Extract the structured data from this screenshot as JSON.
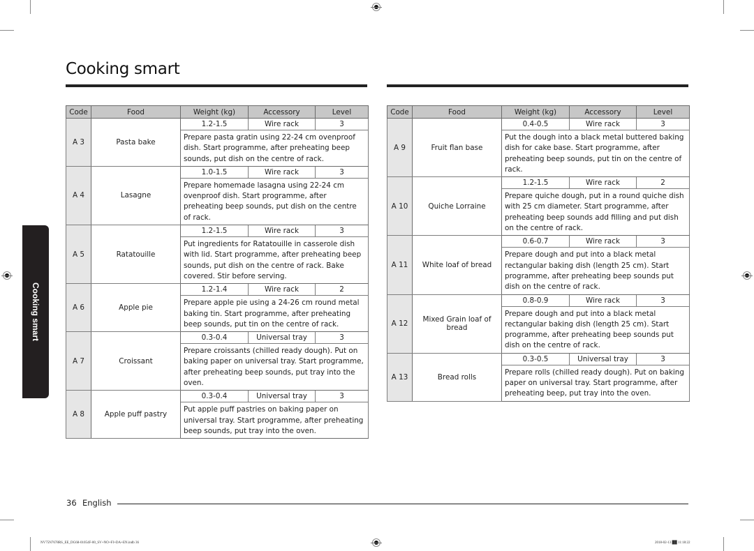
{
  "page": {
    "title": "Cooking smart",
    "side_tab": "Cooking smart",
    "page_number": "36",
    "language": "English"
  },
  "table_headers": {
    "code": "Code",
    "food": "Food",
    "weight": "Weight (kg)",
    "accessory": "Accessory",
    "level": "Level"
  },
  "left_table": [
    {
      "code": "A 3",
      "food": "Pasta bake",
      "weight": "1.2-1.5",
      "accessory": "Wire rack",
      "level": "3",
      "instructions": "Prepare pasta gratin using 22-24 cm ovenproof dish. Start programme, after preheating beep sounds, put dish on the centre of rack."
    },
    {
      "code": "A 4",
      "food": "Lasagne",
      "weight": "1.0-1.5",
      "accessory": "Wire rack",
      "level": "3",
      "instructions": "Prepare homemade lasagna using 22-24 cm ovenproof dish. Start programme, after preheating beep sounds, put dish on the centre of rack."
    },
    {
      "code": "A 5",
      "food": "Ratatouille",
      "weight": "1.2-1.5",
      "accessory": "Wire rack",
      "level": "3",
      "instructions": "Put ingredients for Ratatouille in casserole dish with lid. Start programme, after preheating beep sounds, put dish on the centre of rack. Bake covered. Stir before serving."
    },
    {
      "code": "A 6",
      "food": "Apple pie",
      "weight": "1.2-1.4",
      "accessory": "Wire rack",
      "level": "2",
      "instructions": "Prepare apple pie using a 24-26 cm round metal baking tin. Start programme, after preheating beep sounds, put tin on the centre of rack."
    },
    {
      "code": "A 7",
      "food": "Croissant",
      "weight": "0.3-0.4",
      "accessory": "Universal tray",
      "level": "3",
      "instructions": "Prepare croissants (chilled ready dough). Put on baking paper on universal tray. Start programme, after preheating beep sounds, put tray into the oven."
    },
    {
      "code": "A 8",
      "food": "Apple puff pastry",
      "weight": "0.3-0.4",
      "accessory": "Universal tray",
      "level": "3",
      "instructions": "Put apple puff pastries on baking paper on universal tray. Start programme, after preheating beep sounds, put tray into the oven."
    }
  ],
  "right_table": [
    {
      "code": "A 9",
      "food": "Fruit flan base",
      "weight": "0.4-0.5",
      "accessory": "Wire rack",
      "level": "3",
      "instructions": "Put the dough into a black metal buttered baking dish for cake base. Start programme, after preheating beep sounds, put tin on the centre of rack."
    },
    {
      "code": "A 10",
      "food": "Quiche Lorraine",
      "weight": "1.2-1.5",
      "accessory": "Wire rack",
      "level": "2",
      "instructions": "Prepare quiche dough, put in a round quiche dish with 25 cm diameter. Start programme, after preheating beep sounds add filling and put dish on the centre of rack."
    },
    {
      "code": "A 11",
      "food": "White loaf of bread",
      "weight": "0.6-0.7",
      "accessory": "Wire rack",
      "level": "3",
      "instructions": "Prepare dough and put into a black metal rectangular baking dish (length 25 cm). Start programme, after preheating beep sounds put dish on the centre of rack."
    },
    {
      "code": "A 12",
      "food": "Mixed Grain loaf of bread",
      "weight": "0.8-0.9",
      "accessory": "Wire rack",
      "level": "3",
      "instructions": "Prepare dough and put into a black metal rectangular baking dish (length 25 cm). Start programme, after preheating beep sounds put dish on the centre of rack."
    },
    {
      "code": "A 13",
      "food": "Bread rolls",
      "weight": "0.3-0.5",
      "accessory": "Universal tray",
      "level": "3",
      "instructions": "Prepare rolls (chilled ready dough). Put on baking paper on universal tray. Start programme, after preheating beep, put tray into the oven."
    }
  ],
  "print_slug": {
    "file": "NV75N7678RS_EE_DG68-01054F-00_SV+NO+FI+DA+EN.indb   36",
    "timestamp": "2018-02-13   ██ 11:18:22"
  }
}
